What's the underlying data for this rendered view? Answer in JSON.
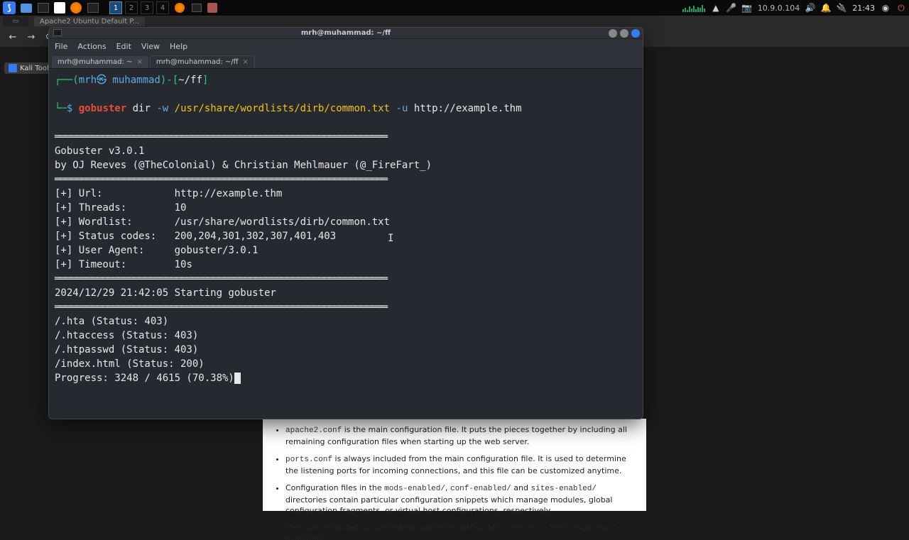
{
  "taskbar": {
    "workspaces": [
      "1",
      "2",
      "3",
      "4"
    ],
    "active_ws": 0,
    "ip": "10.9.0.104",
    "clock": "21:43"
  },
  "browser": {
    "tab_hint": "Apache2 Ubuntu Default P...",
    "tools_label": "Kali Tools"
  },
  "terminal": {
    "window_title": "mrh@muhammad: ~/ff",
    "menu": [
      "File",
      "Actions",
      "Edit",
      "View",
      "Help"
    ],
    "tabs": [
      {
        "label": "mrh@muhammad: ~",
        "active": false
      },
      {
        "label": "mrh@muhammad: ~/ff",
        "active": true
      }
    ],
    "prompt": {
      "user": "mrh㉿ muhammad",
      "path": "~/ff",
      "symbol": "$",
      "cmd_bin": "gobuster",
      "cmd_sub": "dir",
      "flag_w": "-w",
      "wordlist": "/usr/share/wordlists/dirb/common.txt",
      "flag_u": "-u",
      "target": "http://example.thm"
    },
    "divider_s": "═══════════════════════════════════════════════════════════════",
    "banner1": "Gobuster v3.0.1",
    "banner2": "by OJ Reeves (@TheColonial) & Christian Mehlmauer (@_FireFart_)",
    "params": {
      "url_k": "[+] Url:",
      "url_v": "http://example.thm",
      "threads_k": "[+] Threads:",
      "threads_v": "10",
      "wordlist_k": "[+] Wordlist:",
      "wordlist_v": "/usr/share/wordlists/dirb/common.txt",
      "codes_k": "[+] Status codes:",
      "codes_v": "200,204,301,302,307,401,403",
      "ua_k": "[+] User Agent:",
      "ua_v": "gobuster/3.0.1",
      "timeout_k": "[+] Timeout:",
      "timeout_v": "10s"
    },
    "start_line": "2024/12/29 21:42:05 Starting gobuster",
    "results": [
      "/.hta (Status: 403)",
      "/.htaccess (Status: 403)",
      "/.htpasswd (Status: 403)",
      "/index.html (Status: 200)"
    ],
    "progress": "Progress: 3248 / 4615 (70.38%)"
  },
  "apache": {
    "li1a": "apache2.conf",
    "li1b": " is the main configuration file. It puts the pieces together by including all remaining configuration files when starting up the web server.",
    "li2a": "ports.conf",
    "li2b": " is always included from the main configuration file. It is used to determine the listening ports for incoming connections, and this file can be customized anytime.",
    "li3a": "Configuration files in the ",
    "li3b": "mods-enabled/",
    "li3c": ", ",
    "li3d": "conf-enabled/",
    "li3e": " and ",
    "li3f": "sites-enabled/",
    "li3g": " directories contain particular configuration snippets which manage modules, global configuration fragments, or virtual host configurations, respectively.",
    "li4": "They are activated by symlinking available configuration files from their respective *-available/"
  }
}
